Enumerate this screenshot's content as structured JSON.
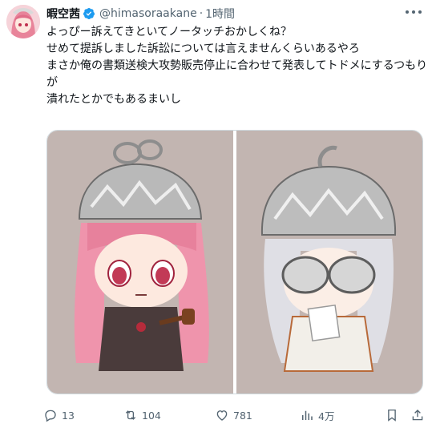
{
  "author": {
    "display_name": "暇空茜",
    "handle": "@himasoraakane",
    "separator": "·",
    "time": "1時間",
    "verified_icon": "verified-badge-icon"
  },
  "tweet": {
    "lines": [
      "よっぴー訴えてきといてノータッチおかしくね？",
      "せめて提訴しました訴訟については言えませんくらいあるやろ",
      "まさか俺の書類送検大攻勢販売停止に合わせて発表してトドメにするつもり",
      "が",
      "潰れたとかでもあるまいし"
    ]
  },
  "media": {
    "panels": [
      {
        "icon": "character-illustration-pink-hair"
      },
      {
        "icon": "character-illustration-silver-hair"
      }
    ],
    "background_color": "#c2b5b1"
  },
  "actions": {
    "reply_count": "13",
    "repost_count": "104",
    "like_count": "781",
    "view_count": "4万"
  },
  "colors": {
    "text": "#0f1419",
    "secondary": "#536471",
    "verified": "#1d9bf0",
    "border": "#cfd9de"
  }
}
